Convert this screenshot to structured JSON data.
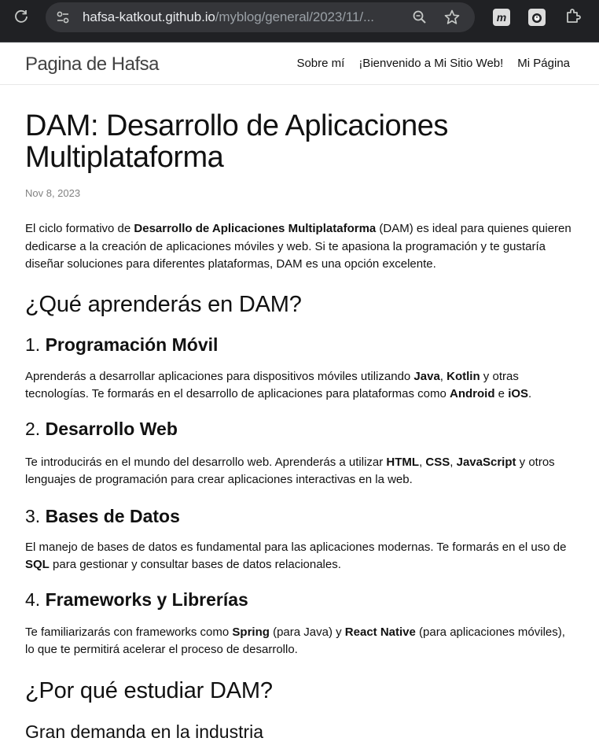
{
  "browser": {
    "url_host": "hafsa-katkout.github.io",
    "url_path": "/myblog/general/2023/11/..."
  },
  "site": {
    "title": "Pagina de Hafsa",
    "nav": [
      "Sobre mí",
      "¡Bienvenido a Mi Sitio Web!",
      "Mi Página"
    ]
  },
  "post": {
    "title": "DAM: Desarrollo de Aplicaciones Multiplataforma",
    "date": "Nov 8, 2023",
    "intro_1": "El ciclo formativo de ",
    "intro_bold": "Desarrollo de Aplicaciones Multiplataforma",
    "intro_2": " (DAM) es ideal para quienes quieren dedicarse a la creación de aplicaciones móviles y web. Si te apasiona la programación y te gustaría diseñar soluciones para diferentes plataformas, DAM es una opción excelente.",
    "h2_learn": "¿Qué aprenderás en DAM?",
    "sections": [
      {
        "num": "1. ",
        "title": "Programación Móvil",
        "t1": "Aprenderás a desarrollar aplicaciones para dispositivos móviles utilizando ",
        "b1": "Java",
        "t2": ", ",
        "b2": "Kotlin",
        "t3": " y otras tecnologías. Te formarás en el desarrollo de aplicaciones para plataformas como ",
        "b3": "Android",
        "t4": " e ",
        "b4": "iOS",
        "t5": "."
      },
      {
        "num": "2. ",
        "title": "Desarrollo Web",
        "t1": "Te introducirás en el mundo del desarrollo web. Aprenderás a utilizar ",
        "b1": "HTML",
        "t2": ", ",
        "b2": "CSS",
        "t3": ", ",
        "b3": "JavaScript",
        "t4": " y otros lenguajes de programación para crear aplicaciones interactivas en la web."
      },
      {
        "num": "3. ",
        "title": "Bases de Datos",
        "t1": "El manejo de bases de datos es fundamental para las aplicaciones modernas. Te formarás en el uso de ",
        "b1": "SQL",
        "t2": " para gestionar y consultar bases de datos relacionales."
      },
      {
        "num": "4. ",
        "title": "Frameworks y Librerías",
        "t1": "Te familiarizarás con frameworks como ",
        "b1": "Spring",
        "t2": " (para Java) y ",
        "b2": "React Native",
        "t3": " (para aplicaciones móviles), lo que te permitirá acelerar el proceso de desarrollo."
      }
    ],
    "h2_why": "¿Por qué estudiar DAM?",
    "h3_demand": "Gran demanda en la industria"
  }
}
